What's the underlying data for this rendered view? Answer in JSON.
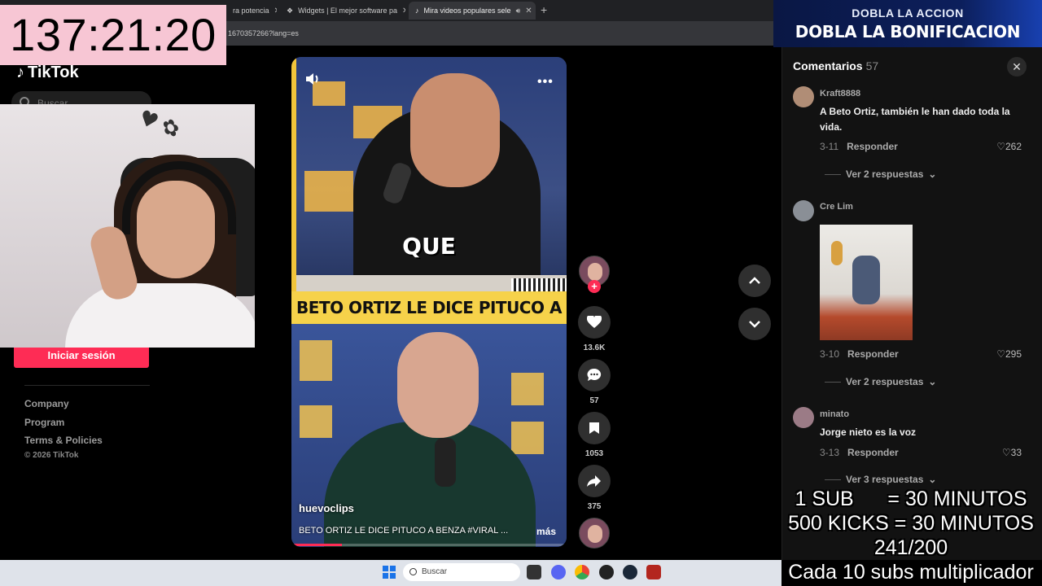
{
  "timer": "137:21:20",
  "browser": {
    "tabs": [
      {
        "label": "ra potencia",
        "icon": "tab-favicon"
      },
      {
        "label": "Widgets | El mejor software pa",
        "icon": "tab-favicon"
      },
      {
        "label": "Mira videos populares sele",
        "icon": "tiktok-favicon",
        "active": true
      }
    ],
    "url": "1670357266?lang=es"
  },
  "promo": {
    "line1": "DOBLA LA ACCION",
    "line2": "DOBLA LA BONIFICACION"
  },
  "sidebar": {
    "logo": "TikTok",
    "search_placeholder": "Buscar",
    "login_label": "Iniciar sesión",
    "links": [
      "Company",
      "Program",
      "Terms & Policies"
    ],
    "copyright": "© 2026 TikTok"
  },
  "video": {
    "caption_word": "QUE",
    "banner": "BETO ORTIZ LE DICE PITUCO A BENZA",
    "author": "huevoclips",
    "description": "BETO ORTIZ LE DICE PITUCO A BENZA #VIRAL ...",
    "more_label": "más",
    "progress": 0.18
  },
  "actions": {
    "likes": "13.6K",
    "comments": "57",
    "saves": "1053",
    "shares": "375"
  },
  "comments": {
    "title": "Comentarios",
    "count": "57",
    "items": [
      {
        "user": "Kraft8888",
        "text": "A Beto Ortiz, también le han dado toda la vida.",
        "date": "3-11",
        "reply": "Responder",
        "likes": "262",
        "more": "Ver 2 respuestas"
      },
      {
        "user": "Cre Lim",
        "text": "",
        "date": "3-10",
        "reply": "Responder",
        "likes": "295",
        "more": "Ver 2 respuestas"
      },
      {
        "user": "minato",
        "text": "Jorge nieto es la voz",
        "date": "3-13",
        "reply": "Responder",
        "likes": "33",
        "more": "Ver 3 respuestas"
      }
    ]
  },
  "rules": {
    "line1": "1 SUB      = 30 MINUTOS",
    "line2": "500 KICKS = 30 MINUTOS",
    "line3": "241/200",
    "line4": "Cada 10 subs multiplicador"
  },
  "taskbar": {
    "search_placeholder": "Buscar"
  },
  "colors": {
    "accent": "#fe2c55",
    "timer_bg": "#f7c6d4",
    "promo_bg": "#0c1f5c"
  }
}
